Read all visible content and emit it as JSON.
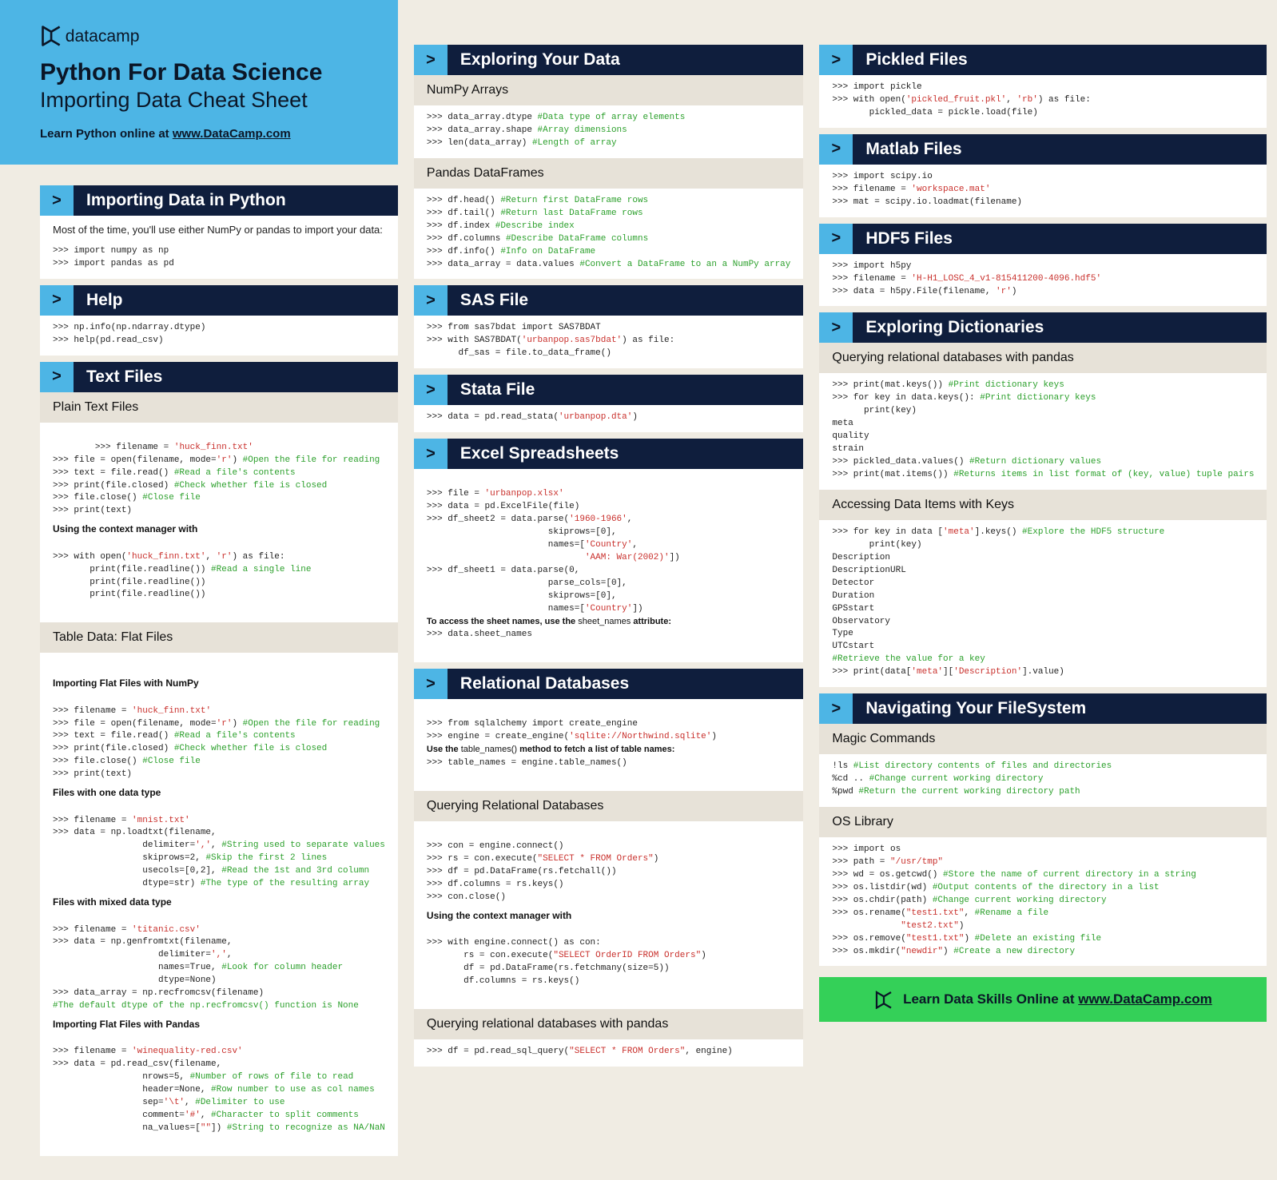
{
  "brand": "datacamp",
  "title": "Python For Data Science",
  "subtitle": "Importing Data Cheat Sheet",
  "learn_prefix": "Learn Python online at ",
  "learn_url": "www.DataCamp.com",
  "footer_prefix": "Learn Data Skills Online at ",
  "footer_url": "www.DataCamp.com",
  "chevron": ">",
  "sections": {
    "s1": "Importing Data in Python",
    "s2": "Help",
    "s3": "Text Files",
    "s4": "Exploring Your Data",
    "s5": "SAS File",
    "s6": "Stata File",
    "s7": "Excel Spreadsheets",
    "s8": "Relational Databases",
    "s9": "Pickled Files",
    "s10": "Matlab Files",
    "s11": "HDF5 Files",
    "s12": "Exploring Dictionaries",
    "s13": "Navigating Your FileSystem"
  },
  "subheads": {
    "plain": "Plain Text Files",
    "table": "Table Data: Flat Files",
    "numpy_arr": "NumPy Arrays",
    "pd_df": "Pandas DataFrames",
    "qrdb": "Querying Relational Databases",
    "qrdbp": "Querying relational databases with pandas",
    "qrdbp2": "Querying relational databases with pandas",
    "access_keys": "Accessing Data Items with Keys",
    "magic": "Magic Commands",
    "oslib": "OS Library"
  },
  "notes": {
    "intro": "Most of the time, you'll use either NumPy or pandas to import  your data:",
    "ctx": "Using the context manager with",
    "np_head": "Importing Flat Files with NumPy",
    "one_dtype": "Files with one data type",
    "mixed": "Files with mixed data type",
    "pd_head": "Importing Flat Files with Pandas",
    "sheet_note_pre": "To access the sheet names, use the ",
    "sheet_note_mid": "sheet_names",
    "sheet_note_post": " attribute:",
    "table_note_pre": "Use the ",
    "table_note_mid": "table_names()",
    "table_note_post": " method to fetch a list of table names:"
  },
  "code": {
    "import_np_pd": ">>> import numpy as np\n>>> import pandas as pd",
    "help": ">>> np.info(np.ndarray.dtype)\n>>> help(pd.read_csv)",
    "plain1": ">>> filename = <span class='c-str'>'huck_finn.txt'</span>\n>>> file = open(filename, mode=<span class='c-str'>'r'</span>) <span class='c-com'>#Open the file for reading</span>\n>>> text = file.read() <span class='c-com'>#Read a file's contents</span>\n>>> print(file.closed) <span class='c-com'>#Check whether file is closed</span>\n>>> file.close() <span class='c-com'>#Close file</span>\n>>> print(text)",
    "plain2": ">>> with open(<span class='c-str'>'huck_finn.txt'</span>, <span class='c-str'>'r'</span>) as file:\n       print(file.readline()) <span class='c-com'>#Read a single line</span>\n       print(file.readline())\n       print(file.readline())",
    "flat_np1": ">>> filename = <span class='c-str'>'huck_finn.txt'</span>\n>>> file = open(filename, mode=<span class='c-str'>'r'</span>) <span class='c-com'>#Open the file for reading</span>\n>>> text = file.read() <span class='c-com'>#Read a file's contents</span>\n>>> print(file.closed) <span class='c-com'>#Check whether file is closed</span>\n>>> file.close() <span class='c-com'>#Close file</span>\n>>> print(text)",
    "flat_np2": ">>> filename = <span class='c-str'>'mnist.txt'</span>\n>>> data = np.loadtxt(filename,\n                 delimiter=<span class='c-str'>','</span>, <span class='c-com'>#String used to separate values</span>\n                 skiprows=2, <span class='c-com'>#Skip the first 2 lines</span>\n                 usecols=[0,2], <span class='c-com'>#Read the 1st and 3rd column</span>\n                 dtype=str) <span class='c-com'>#The type of the resulting array</span>",
    "flat_np3": ">>> filename = <span class='c-str'>'titanic.csv'</span>\n>>> data = np.genfromtxt(filename,\n                    delimiter=<span class='c-str'>','</span>,\n                    names=True, <span class='c-com'>#Look for column header</span>\n                    dtype=None)\n>>> data_array = np.recfromcsv(filename)\n<span class='c-com'>#The default dtype of the np.recfromcsv() function is None</span>",
    "flat_pd": ">>> filename = <span class='c-str'>'winequality-red.csv'</span>\n>>> data = pd.read_csv(filename,\n                 nrows=5, <span class='c-com'>#Number of rows of file to read</span>\n                 header=None, <span class='c-com'>#Row number to use as col names</span>\n                 sep=<span class='c-str'>'\\t'</span>, <span class='c-com'>#Delimiter to use</span>\n                 comment=<span class='c-str'>'#'</span>, <span class='c-com'>#Character to split comments</span>\n                 na_values=[<span class='c-str'>\"\"</span>]) <span class='c-com'>#String to recognize as NA/NaN</span>",
    "numpy_arr": ">>> data_array.dtype <span class='c-com'>#Data type of array elements</span>\n>>> data_array.shape <span class='c-com'>#Array dimensions</span>\n>>> len(data_array) <span class='c-com'>#Length of array</span>",
    "pd_df": ">>> df.head() <span class='c-com'>#Return first DataFrame rows</span>\n>>> df.tail() <span class='c-com'>#Return last DataFrame rows</span>\n>>> df.index <span class='c-com'>#Describe index</span>\n>>> df.columns <span class='c-com'>#Describe DataFrame columns</span>\n>>> df.info() <span class='c-com'>#Info on DataFrame</span>\n>>> data_array = data.values <span class='c-com'>#Convert a DataFrame to an a NumPy array</span>",
    "sas": ">>> from sas7bdat import SAS7BDAT\n>>> with SAS7BDAT(<span class='c-str'>'urbanpop.sas7bdat'</span>) as file:\n      df_sas = file.to_data_frame()",
    "stata": ">>> data = pd.read_stata(<span class='c-str'>'urbanpop.dta'</span>)",
    "excel": ">>> file = <span class='c-str'>'urbanpop.xlsx'</span>\n>>> data = pd.ExcelFile(file)\n>>> df_sheet2 = data.parse(<span class='c-str'>'1960-1966'</span>,\n                       skiprows=[0],\n                       names=[<span class='c-str'>'Country'</span>,\n                              <span class='c-str'>'AAM: War(2002)'</span>])\n>>> df_sheet1 = data.parse(0,\n                       parse_cols=[0],\n                       skiprows=[0],\n                       names=[<span class='c-str'>'Country'</span>])",
    "excel_sheet": ">>> data.sheet_names",
    "rdb1": ">>> from sqlalchemy import create_engine\n>>> engine = create_engine(<span class='c-str'>'sqlite://Northwind.sqlite'</span>)",
    "rdb_tables": ">>> table_names = engine.table_names()",
    "rdb_query": ">>> con = engine.connect()\n>>> rs = con.execute(<span class='c-str'>\"SELECT * FROM Orders\"</span>)\n>>> df = pd.DataFrame(rs.fetchall())\n>>> df.columns = rs.keys()\n>>> con.close()",
    "rdb_ctx": ">>> with engine.connect() as con:\n       rs = con.execute(<span class='c-str'>\"SELECT OrderID FROM Orders\"</span>)\n       df = pd.DataFrame(rs.fetchmany(size=5))\n       df.columns = rs.keys()",
    "rdb_pd": ">>> df = pd.read_sql_query(<span class='c-str'>\"SELECT * FROM Orders\"</span>, engine)",
    "pickle": ">>> import pickle\n>>> with open(<span class='c-str'>'pickled_fruit.pkl'</span>, <span class='c-str'>'rb'</span>) as file:\n       pickled_data = pickle.load(file)",
    "matlab": ">>> import scipy.io\n>>> filename = <span class='c-str'>'workspace.mat'</span>\n>>> mat = scipy.io.loadmat(filename)",
    "hdf5": ">>> import h5py\n>>> filename = <span class='c-str'>'H-H1_LOSC_4_v1-815411200-4096.hdf5'</span>\n>>> data = h5py.File(filename, <span class='c-str'>'r'</span>)",
    "dict1": ">>> print(mat.keys()) <span class='c-com'>#Print dictionary keys</span>\n>>> for key in data.keys(): <span class='c-com'>#Print dictionary keys</span>\n      print(key)\nmeta\nquality\nstrain\n>>> pickled_data.values() <span class='c-com'>#Return dictionary values</span>\n>>> print(mat.items()) <span class='c-com'>#Returns items in list format of (key, value) tuple pairs</span>",
    "dict2": ">>> for key in data [<span class='c-str'>'meta'</span>].keys() <span class='c-com'>#Explore the HDF5 structure</span>\n       print(key)\nDescription\nDescriptionURL\nDetector\nDuration\nGPSstart\nObservatory\nType\nUTCstart\n<span class='c-com'>#Retrieve the value for a key</span>\n>>> print(data[<span class='c-str'>'meta'</span>][<span class='c-str'>'Description'</span>].value)",
    "magic": "!ls <span class='c-com'>#List directory contents of files and directories</span>\n%cd .. <span class='c-com'>#Change current working directory</span>\n%pwd <span class='c-com'>#Return the current working directory path</span>",
    "oslib": ">>> import os\n>>> path = <span class='c-str'>\"/usr/tmp\"</span>\n>>> wd = os.getcwd() <span class='c-com'>#Store the name of current directory in a string</span>\n>>> os.listdir(wd) <span class='c-com'>#Output contents of the directory in a list</span>\n>>> os.chdir(path) <span class='c-com'>#Change current working directory</span>\n>>> os.rename(<span class='c-str'>\"test1.txt\"</span>, <span class='c-com'>#Rename a file</span>\n             <span class='c-str'>\"test2.txt\"</span>)\n>>> os.remove(<span class='c-str'>\"test1.txt\"</span>) <span class='c-com'>#Delete an existing file</span>\n>>> os.mkdir(<span class='c-str'>\"newdir\"</span>) <span class='c-com'>#Create a new directory</span>"
  }
}
